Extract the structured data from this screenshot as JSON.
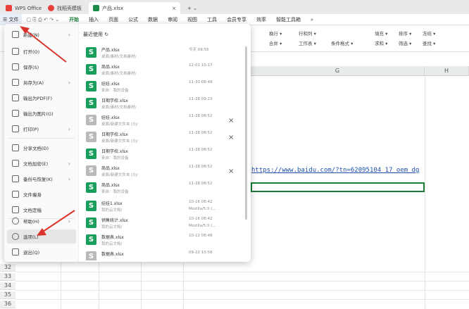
{
  "titlebar": {
    "tabs": [
      {
        "label": "WPS Office",
        "color": "#e8413b"
      },
      {
        "label": "找稻壳模板",
        "color": "#e8413b"
      },
      {
        "label": "产品.xlsx",
        "color": "#1a8a48"
      }
    ],
    "close_tab": "×",
    "new_tab": "+ ⌄"
  },
  "menubar": {
    "file_label": "☰ 文件",
    "items": [
      "开始",
      "插入",
      "页面",
      "公式",
      "数据",
      "审阅",
      "视图",
      "工具",
      "会员专享",
      "效率",
      "智能工具箱"
    ],
    "active": "开始"
  },
  "ribbon": {
    "items": [
      "换行 ▾",
      "合并 ▾",
      "行和列 ▾",
      "工作表 ▾",
      "条件格式 ▾",
      "填充 ▾",
      "排序 ▾",
      "冻结 ▾",
      "求和 ▾",
      "筛选 ▾",
      "查找 ▾"
    ]
  },
  "columns": {
    "g_label": "G",
    "h_label": "H"
  },
  "rows": [
    "32",
    "33",
    "34",
    "35",
    "36"
  ],
  "cell_url": "https://www.baidu.com/?tn=62095104_17_oem_dg",
  "filemenu": {
    "items": [
      {
        "label": "新建(N)",
        "arrow": "›"
      },
      {
        "label": "打开(O)",
        "arrow": ""
      },
      {
        "label": "保存(S)",
        "arrow": ""
      },
      {
        "label": "另存为(A)",
        "arrow": "›"
      },
      {
        "label": "输出为PDF(F)",
        "arrow": ""
      },
      {
        "label": "输出为图片(G)",
        "arrow": ""
      },
      {
        "label": "打印(P)",
        "arrow": "›"
      },
      {
        "label": "分享文档(D)",
        "arrow": ""
      },
      {
        "label": "文档加密(E)",
        "arrow": "›"
      },
      {
        "label": "备份与恢复(K)",
        "arrow": "›"
      },
      {
        "label": "文件瘦身",
        "arrow": ""
      },
      {
        "label": "文档定稿",
        "arrow": ""
      },
      {
        "label": "帮助(H)",
        "arrow": "›"
      },
      {
        "label": "选项(L)",
        "arrow": ""
      },
      {
        "label": "退出(Q)",
        "arrow": ""
      }
    ],
    "recent_title": "最近使用",
    "recent": [
      {
        "name": "产品.xlsx",
        "path": "桌面/素材/文档素材/",
        "time": "今天 09:55",
        "time2": "",
        "color": "#1a9e5c",
        "close": ""
      },
      {
        "name": "商品.xlsx",
        "path": "桌面/素材/文档素材/",
        "time": "12-01 10:17",
        "time2": "",
        "color": "#1a9e5c",
        "close": ""
      },
      {
        "name": "娃娃.xlsx",
        "path": "来自：我的设备",
        "time": "11-30 08:49",
        "time2": "",
        "color": "#1a9e5c",
        "close": ""
      },
      {
        "name": "日期学校.xlsx",
        "path": "桌面/素材/文档素材/",
        "time": "11-28 09:23",
        "time2": "",
        "color": "#1a9e5c",
        "close": ""
      },
      {
        "name": "娃娃.xlsx",
        "path": "桌面/新建文件夹 (3)/",
        "time": "11-28 08:52",
        "time2": "",
        "color": "#b9b9b9",
        "close": "×"
      },
      {
        "name": "日期学校.xlsx",
        "path": "桌面/新建文件夹 (3)/",
        "time": "11-28 08:52",
        "time2": "",
        "color": "#b9b9b9",
        "close": "×"
      },
      {
        "name": "日期学校.xlsx",
        "path": "来自：我的设备",
        "time": "11-28 08:52",
        "time2": "",
        "color": "#1a9e5c",
        "close": ""
      },
      {
        "name": "商品.xlsx",
        "path": "桌面/新建文件夹 (3)/",
        "time": "11-28 08:52",
        "time2": "",
        "color": "#b9b9b9",
        "close": "×"
      },
      {
        "name": "商品.xlsx",
        "path": "来自：我的设备",
        "time": "11-28 08:52",
        "time2": "",
        "color": "#1a9e5c",
        "close": ""
      },
      {
        "name": "娃娃1.xlsx",
        "path": "我的云文档/",
        "time": "10-16 08:42",
        "time2": "Mozilla/5.0 (...",
        "color": "#1a9e5c",
        "close": ""
      },
      {
        "name": "销售统计.xlsx",
        "path": "我的云文档/",
        "time": "10-16 08:42",
        "time2": "Mozilla/5.0 (...",
        "color": "#1a9e5c",
        "close": ""
      },
      {
        "name": "数据表.xlsx",
        "path": "我的云文档/",
        "time": "10-12 08:48",
        "time2": "",
        "color": "#1a9e5c",
        "close": ""
      },
      {
        "name": "数据表.xlsx",
        "path": "",
        "time": "09-22 10:58",
        "time2": "",
        "color": "#b9b9b9",
        "close": ""
      }
    ]
  },
  "colors": {
    "accent": "#1a7f37",
    "arrow": "#d9342b"
  }
}
